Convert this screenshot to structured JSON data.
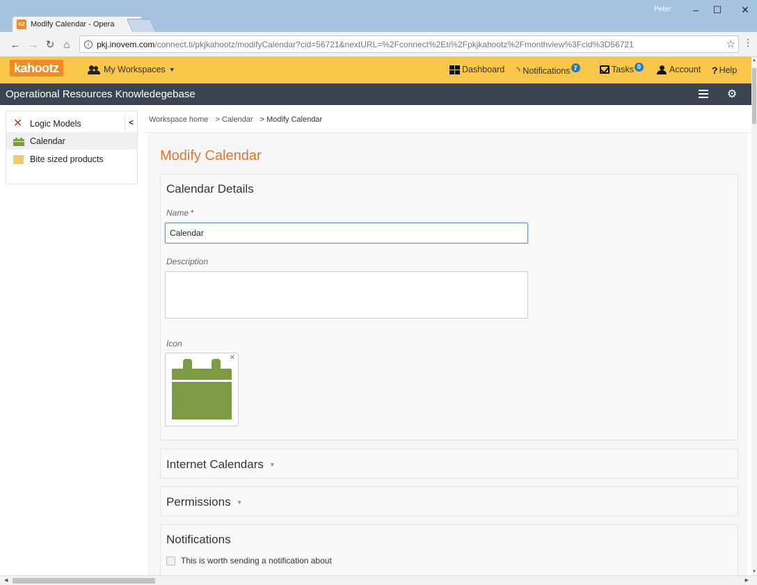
{
  "browser": {
    "tab_title": "Modify Calendar - Opera",
    "favicon_text": "KZ",
    "user": "Peter",
    "url_host": "pkj.inovem.com",
    "url_rest": "/connect.ti/pkjkahootz/modifyCalendar?cid=56721&nextURL=%2Fconnect%2Eti%2Fpkjkahootz%2Fmonthview%3Fcid%3D56721"
  },
  "appbar": {
    "logo": "kahootz",
    "workspaces_label": "My Workspaces",
    "dashboard_label": "Dashboard",
    "notifications_label": "Notifications",
    "notifications_count": "7",
    "tasks_label": "Tasks",
    "tasks_count": "0",
    "account_label": "Account",
    "help_label": "Help"
  },
  "workspace": {
    "title": "Operational Resources Knowledegebase"
  },
  "sidebar": {
    "items": [
      {
        "label": "Logic Models"
      },
      {
        "label": "Calendar"
      },
      {
        "label": "Bite sized products"
      }
    ],
    "collapse_label": "<"
  },
  "breadcrumb": {
    "items": [
      "Workspace home",
      "> Calendar",
      "> Modify Calendar"
    ]
  },
  "main": {
    "page_title": "Modify Calendar",
    "details": {
      "title": "Calendar Details",
      "name_label": "Name",
      "required_mark": "*",
      "name_value": "Calendar",
      "description_label": "Description",
      "icon_label": "Icon"
    },
    "internet_calendars_title": "Internet Calendars",
    "permissions_title": "Permissions",
    "notifications": {
      "title": "Notifications",
      "checkbox_label": "This is worth sending a notification about"
    }
  },
  "colors": {
    "accent_orange": "#e8742c",
    "appbar_yellow": "#f8c74a",
    "workspace_bar": "#3b4551",
    "calendar_green": "#7d9a44",
    "badge_blue": "#2a7ab5"
  }
}
